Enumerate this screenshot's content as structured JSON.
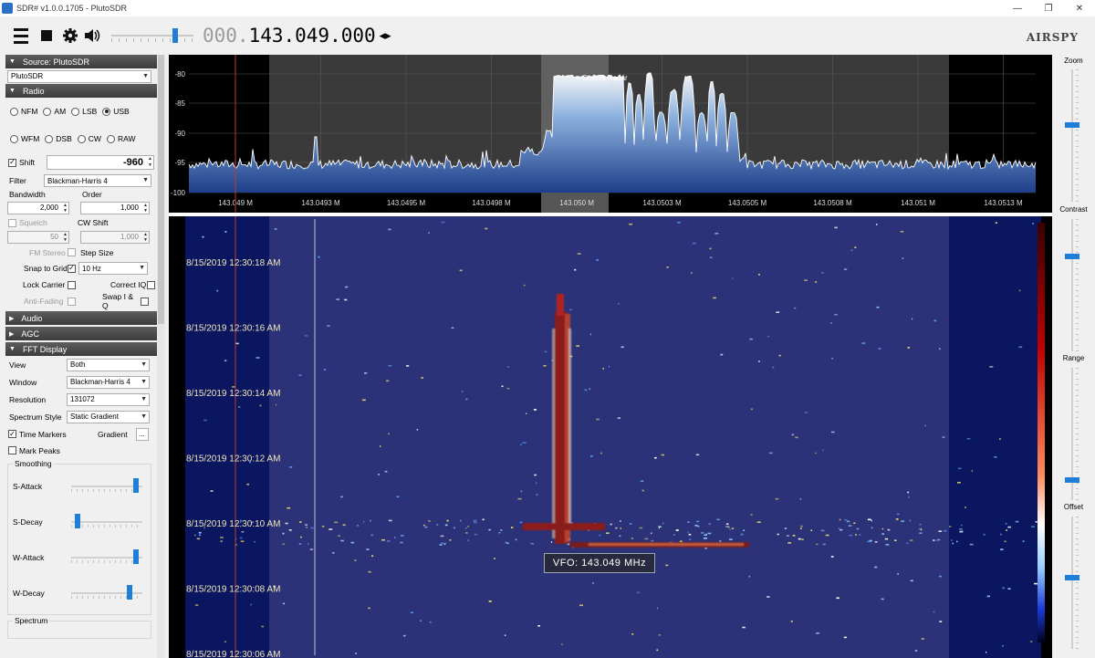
{
  "window": {
    "title": "SDR# v1.0.0.1705 - PlutoSDR",
    "minimize": "—",
    "restore": "❐",
    "close": "✕"
  },
  "toolbar": {
    "freq_dim": "000.",
    "freq_main": "143.049.000",
    "freq_arrows": "◂▸",
    "logo": "AIRSPY",
    "volume_level": 0.8
  },
  "source": {
    "header": "Source: PlutoSDR",
    "device": "PlutoSDR"
  },
  "radio": {
    "header": "Radio",
    "modes_row1": [
      {
        "label": "NFM",
        "selected": false
      },
      {
        "label": "AM",
        "selected": false
      },
      {
        "label": "LSB",
        "selected": false
      },
      {
        "label": "USB",
        "selected": true
      }
    ],
    "modes_row2": [
      {
        "label": "WFM",
        "selected": false
      },
      {
        "label": "DSB",
        "selected": false
      },
      {
        "label": "CW",
        "selected": false
      },
      {
        "label": "RAW",
        "selected": false
      }
    ],
    "shift_label": "Shift",
    "shift_value": "-960",
    "filter_label": "Filter",
    "filter_value": "Blackman-Harris 4",
    "bandwidth_label": "Bandwidth",
    "bandwidth_value": "2,000",
    "order_label": "Order",
    "order_value": "1,000",
    "squelch_label": "Squelch",
    "squelch_value": "50",
    "cw_shift_label": "CW Shift",
    "cw_shift_value": "1,000",
    "fm_stereo_label": "FM Stereo",
    "step_size_label": "Step Size",
    "snap_label": "Snap to Grid",
    "snap_value": "10 Hz",
    "lock_carrier_label": "Lock Carrier",
    "correct_iq_label": "Correct IQ",
    "anti_fading_label": "Anti-Fading",
    "swap_iq_label": "Swap I & Q"
  },
  "audio": {
    "header": "Audio"
  },
  "agc": {
    "header": "AGC"
  },
  "fft": {
    "header": "FFT Display",
    "view_label": "View",
    "view_value": "Both",
    "window_label": "Window",
    "window_value": "Blackman-Harris 4",
    "resolution_label": "Resolution",
    "resolution_value": "131072",
    "style_label": "Spectrum Style",
    "style_value": "Static Gradient",
    "time_markers_label": "Time Markers",
    "gradient_label": "Gradient",
    "gradient_btn": "...",
    "mark_peaks_label": "Mark Peaks",
    "smoothing_label": "Smoothing",
    "sliders": [
      {
        "label": "S-Attack",
        "level": 0.95
      },
      {
        "label": "S-Decay",
        "level": 0.05
      },
      {
        "label": "W-Attack",
        "level": 0.95
      },
      {
        "label": "W-Decay",
        "level": 0.85
      }
    ],
    "spectrum_label": "Spectrum"
  },
  "spectrum": {
    "y_labels": [
      "-80",
      "-85",
      "-90",
      "-95",
      "-100"
    ],
    "x_labels": [
      "143.049 M",
      "143.0493 M",
      "143.0495 M",
      "143.0498 M",
      "143.050 M",
      "143.0503 M",
      "143.0505 M",
      "143.0508 M",
      "143.051 M",
      "143.0513 M"
    ],
    "annotation": "< Graves Radar"
  },
  "waterfall": {
    "timestamps": [
      "8/15/2019 12:30:18 AM",
      "8/15/2019 12:30:16 AM",
      "8/15/2019 12:30:14 AM",
      "8/15/2019 12:30:12 AM",
      "8/15/2019 12:30:10 AM",
      "8/15/2019 12:30:08 AM",
      "8/15/2019 12:30:06 AM"
    ],
    "vfo_tooltip": "VFO: 143.049 MHz"
  },
  "right_controls": {
    "zoom_label": "Zoom",
    "contrast_label": "Contrast",
    "range_label": "Range",
    "offset_label": "Offset"
  },
  "colors": {
    "accent": "#1f7fd6",
    "waterfall_bg": "#2b3278",
    "waterfall_edge": "#0a1660",
    "trace": "#ffffff",
    "marker": "#c0392b"
  }
}
